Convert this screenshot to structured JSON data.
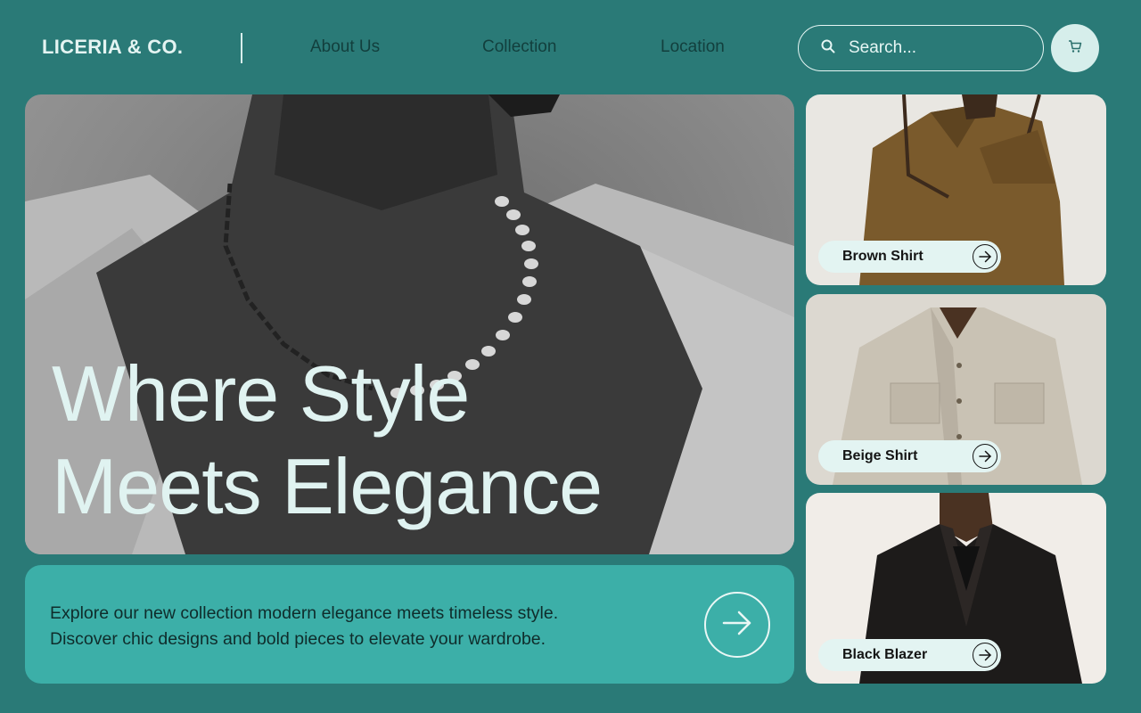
{
  "header": {
    "brand": "LICERIA & CO.",
    "nav": [
      {
        "label": "About Us"
      },
      {
        "label": "Collection"
      },
      {
        "label": "Location"
      }
    ],
    "search": {
      "placeholder": "Search...",
      "icon": "search-icon"
    },
    "cart": {
      "icon": "cart-icon"
    }
  },
  "hero": {
    "title_line1": "Where Style",
    "title_line2": "Meets Elegance"
  },
  "promo": {
    "line1": "Explore our new collection modern elegance meets timeless style.",
    "line2": "Discover chic designs and bold pieces to elevate your wardrobe.",
    "icon": "arrow-right-icon"
  },
  "products": [
    {
      "label": "Brown Shirt"
    },
    {
      "label": "Beige Shirt"
    },
    {
      "label": "Black Blazer"
    }
  ],
  "colors": {
    "background": "#2a7a77",
    "promo": "#3cafa8",
    "light": "#e3f4f2",
    "text_dark": "#123f3d"
  }
}
